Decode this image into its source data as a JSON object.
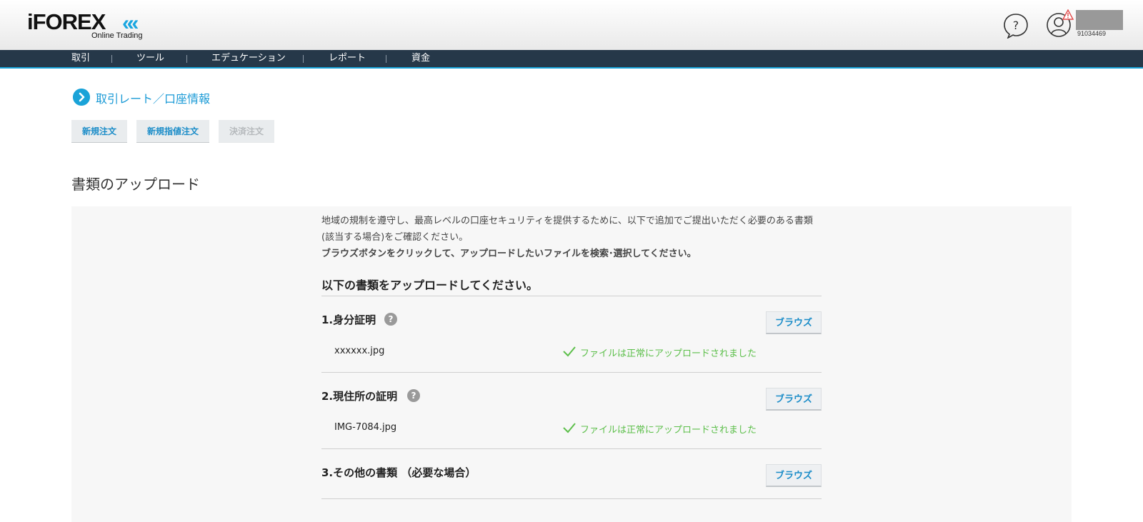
{
  "header": {
    "logo_main": "iFOREX",
    "logo_chevrons": "««",
    "logo_sub": "Online Trading",
    "user_id": "91034469",
    "icons": {
      "help": "help-icon",
      "user": "user-icon",
      "warning": "warning-icon"
    }
  },
  "nav": {
    "items": [
      {
        "label": "取引"
      },
      {
        "label": "ツール"
      },
      {
        "label": "エデュケーション"
      },
      {
        "label": "レポート"
      },
      {
        "label": "資金"
      }
    ]
  },
  "breadcrumb": {
    "label": "取引レート／口座情報"
  },
  "order_buttons": {
    "new_order": "新規注文",
    "new_limit_order": "新規指値注文",
    "close_order": "決済注文"
  },
  "section": {
    "title": "書類のアップロード",
    "desc_line1": "地域の規制を遵守し、最高レベルの口座セキュリティを提供するために、以下で追加でご提出いただく必要のある書類",
    "desc_line2": "(該当する場合)をご確認ください。",
    "desc_line3": "ブラウズボタンをクリックして、アップロードしたいファイルを検索･選択してください。",
    "upload_heading": "以下の書類をアップロードしてください。",
    "browse_label": "ブラウズ",
    "documents": [
      {
        "title": "1.身分証明",
        "has_help": true,
        "file": "xxxxxx.jpg",
        "status": "ファイルは正常にアップロードされました"
      },
      {
        "title": "2.現住所の証明",
        "has_help": true,
        "file": "IMG-7084.jpg",
        "status": "ファイルは正常にアップロードされました"
      },
      {
        "title": "3.その他の書類 （必要な場合）",
        "has_help": false
      }
    ]
  },
  "colors": {
    "nav_bg": "#263849",
    "accent": "#1aa3d8",
    "success": "#5cbf4a",
    "panel_bg": "#f7f7f7"
  }
}
